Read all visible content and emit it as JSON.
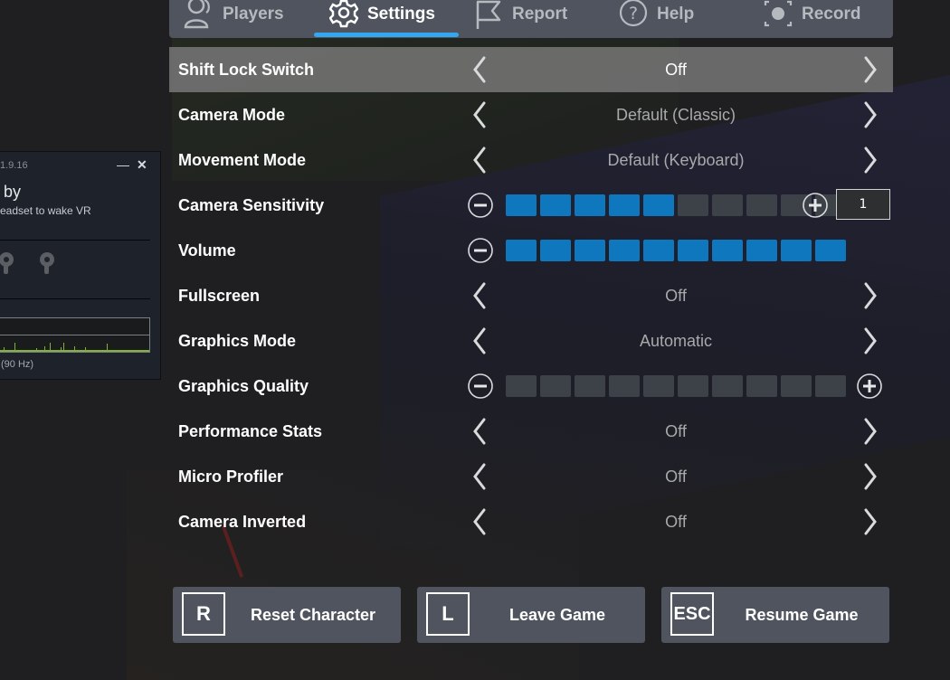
{
  "vr_window": {
    "version": "1.9.16",
    "minimize_icon": "minimize-icon",
    "close_icon": "close-icon",
    "title": "by",
    "subtitle": "eadset to wake VR",
    "status": "(90 Hz)"
  },
  "tabs": [
    {
      "label": "Players",
      "icon": "players-icon",
      "active": false
    },
    {
      "label": "Settings",
      "icon": "gear-icon",
      "active": true
    },
    {
      "label": "Report",
      "icon": "flag-icon",
      "active": false
    },
    {
      "label": "Help",
      "icon": "help-icon",
      "active": false
    },
    {
      "label": "Record",
      "icon": "record-icon",
      "active": false
    }
  ],
  "accent_color": "#33a8f0",
  "settings": [
    {
      "name": "Shift Lock Switch",
      "type": "selector",
      "value": "Off",
      "selected": true
    },
    {
      "name": "Camera Mode",
      "type": "selector",
      "value": "Default (Classic)"
    },
    {
      "name": "Movement Mode",
      "type": "selector",
      "value": "Default (Keyboard)"
    },
    {
      "name": "Camera Sensitivity",
      "type": "slider",
      "level": 5,
      "max": 10,
      "input_value": "1"
    },
    {
      "name": "Volume",
      "type": "slider",
      "level": 10,
      "max": 10
    },
    {
      "name": "Fullscreen",
      "type": "selector",
      "value": "Off"
    },
    {
      "name": "Graphics Mode",
      "type": "selector",
      "value": "Automatic"
    },
    {
      "name": "Graphics Quality",
      "type": "slider",
      "level": 0,
      "max": 10
    },
    {
      "name": "Performance Stats",
      "type": "selector",
      "value": "Off"
    },
    {
      "name": "Micro Profiler",
      "type": "selector",
      "value": "Off"
    },
    {
      "name": "Camera Inverted",
      "type": "selector",
      "value": "Off"
    }
  ],
  "buttons": [
    {
      "key": "R",
      "label": "Reset Character"
    },
    {
      "key": "L",
      "label": "Leave Game"
    },
    {
      "key": "ESC",
      "label": "Resume Game"
    }
  ]
}
